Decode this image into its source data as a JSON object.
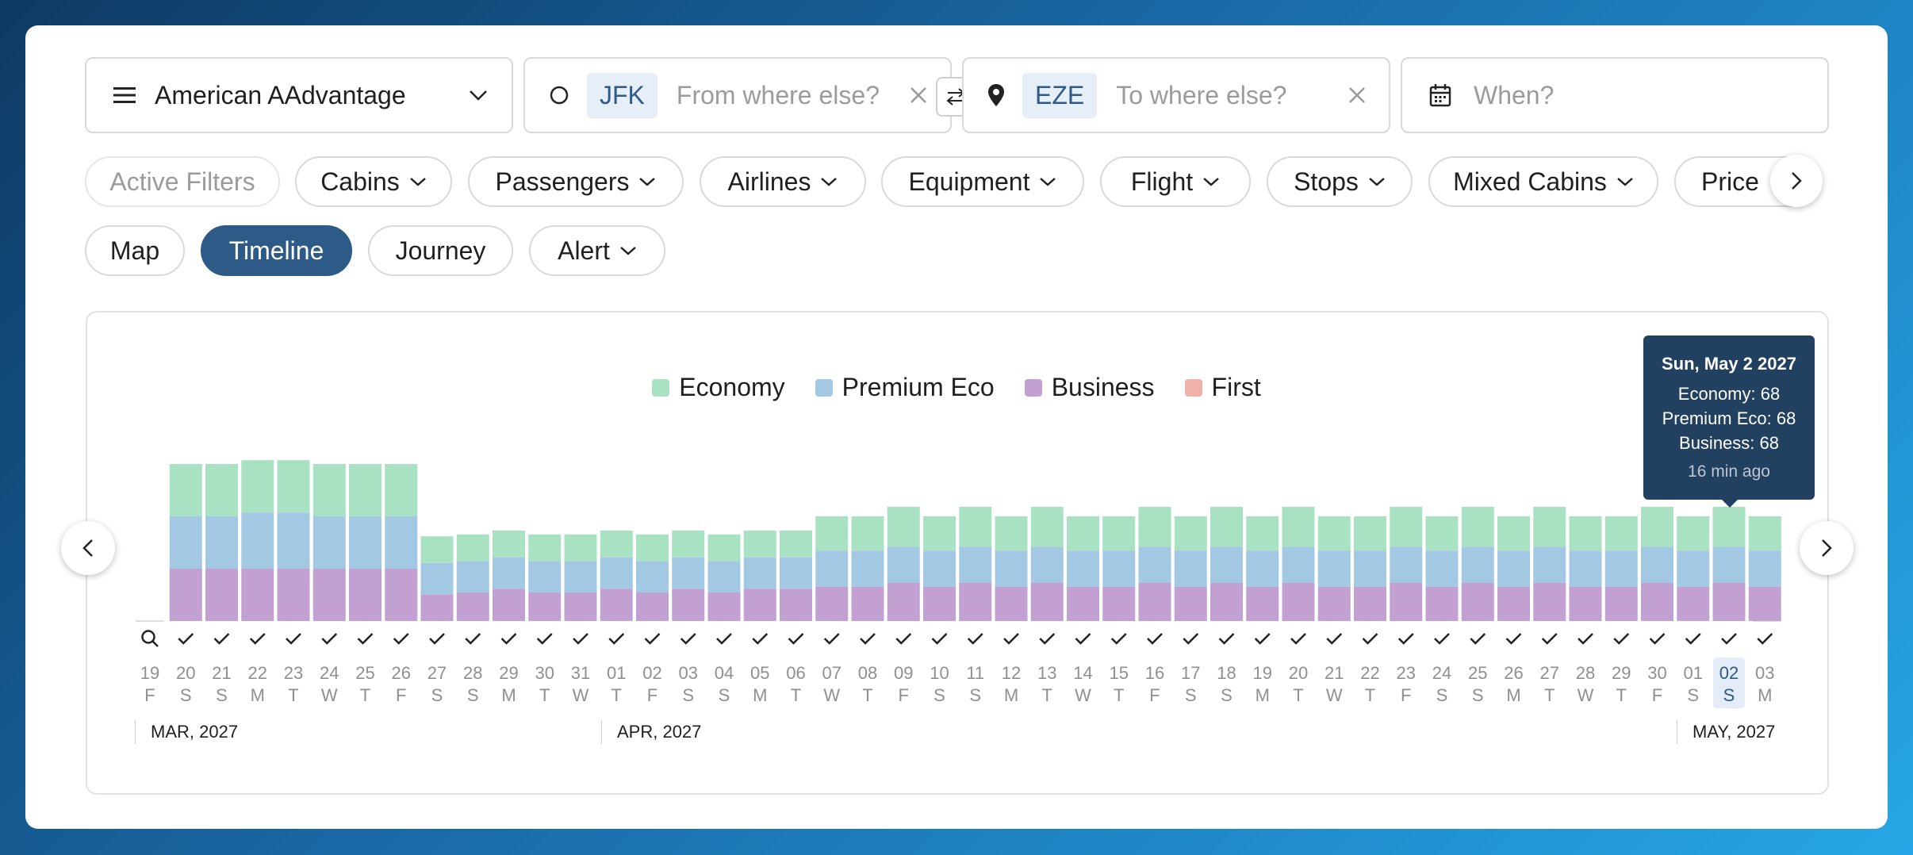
{
  "program": {
    "label": "American AAdvantage"
  },
  "from": {
    "code": "JFK",
    "placeholder": "From where else?"
  },
  "to": {
    "code": "EZE",
    "placeholder": "To where else?"
  },
  "when": {
    "placeholder": "When?"
  },
  "filters": {
    "active": "Active Filters",
    "items": [
      "Cabins",
      "Passengers",
      "Airlines",
      "Equipment",
      "Flight",
      "Stops",
      "Mixed Cabins",
      "Price"
    ]
  },
  "views": {
    "map": "Map",
    "timeline": "Timeline",
    "journey": "Journey",
    "alert": "Alert"
  },
  "tooltip": {
    "title": "Sun, May 2 2027",
    "economy": "Economy: 68",
    "premium": "Premium Eco: 68",
    "business": "Business: 68",
    "age": "16 min ago"
  },
  "months": [
    "MAR, 2027",
    "APR, 2027",
    "MAY, 2027"
  ],
  "colors": {
    "economy": "#a8e2c2",
    "premium": "#a3c8e4",
    "business": "#c3a0d2",
    "first": "#f0b2a8",
    "accent": "#2d5a87"
  },
  "chart_data": {
    "type": "bar",
    "stacked": true,
    "series": [
      {
        "name": "Economy",
        "values": [
          55,
          55,
          55,
          55,
          55,
          55,
          55,
          28,
          28,
          28,
          28,
          28,
          28,
          28,
          28,
          28,
          28,
          28,
          36,
          36,
          42,
          36,
          42,
          36,
          42,
          36,
          36,
          42,
          36,
          42,
          36,
          42,
          36,
          36,
          42,
          36,
          42,
          36,
          42,
          36,
          36,
          42,
          36,
          42,
          36
        ]
      },
      {
        "name": "Premium Eco",
        "values": [
          55,
          55,
          59,
          59,
          55,
          55,
          55,
          33,
          33,
          33,
          33,
          33,
          33,
          33,
          33,
          33,
          33,
          33,
          38,
          38,
          38,
          38,
          38,
          38,
          38,
          38,
          38,
          38,
          38,
          38,
          38,
          38,
          38,
          38,
          38,
          38,
          38,
          38,
          38,
          38,
          38,
          38,
          38,
          38,
          38
        ]
      },
      {
        "name": "Business",
        "values": [
          55,
          55,
          55,
          55,
          55,
          55,
          55,
          28,
          30,
          34,
          30,
          30,
          34,
          30,
          34,
          30,
          34,
          34,
          36,
          36,
          40,
          36,
          40,
          36,
          40,
          36,
          36,
          40,
          36,
          40,
          36,
          40,
          36,
          36,
          40,
          36,
          40,
          36,
          40,
          36,
          36,
          40,
          36,
          40,
          36
        ]
      },
      {
        "name": "First",
        "values": [
          0,
          0,
          0,
          0,
          0,
          0,
          0,
          0,
          0,
          0,
          0,
          0,
          0,
          0,
          0,
          0,
          0,
          0,
          0,
          0,
          0,
          0,
          0,
          0,
          0,
          0,
          0,
          0,
          0,
          0,
          0,
          0,
          0,
          0,
          0,
          0,
          0,
          0,
          0,
          0,
          0,
          0,
          0,
          0,
          0
        ]
      }
    ],
    "dates": [
      "19",
      "20",
      "21",
      "22",
      "23",
      "24",
      "25",
      "26",
      "27",
      "28",
      "29",
      "30",
      "31",
      "01",
      "02",
      "03",
      "04",
      "05",
      "06",
      "07",
      "08",
      "09",
      "10",
      "11",
      "12",
      "13",
      "14",
      "15",
      "16",
      "17",
      "18",
      "19",
      "20",
      "21",
      "22",
      "23",
      "24",
      "25",
      "26",
      "27",
      "28",
      "29",
      "30",
      "01",
      "02",
      "03"
    ],
    "weekdays": [
      "F",
      "S",
      "S",
      "M",
      "T",
      "W",
      "T",
      "F",
      "S",
      "S",
      "M",
      "T",
      "W",
      "T",
      "F",
      "S",
      "S",
      "M",
      "T",
      "W",
      "T",
      "F",
      "S",
      "S",
      "M",
      "T",
      "W",
      "T",
      "F",
      "S",
      "S",
      "M",
      "T",
      "W",
      "T",
      "F",
      "S",
      "S",
      "M",
      "T",
      "W",
      "T",
      "F",
      "S",
      "S",
      "M"
    ],
    "selected_index": 44
  }
}
